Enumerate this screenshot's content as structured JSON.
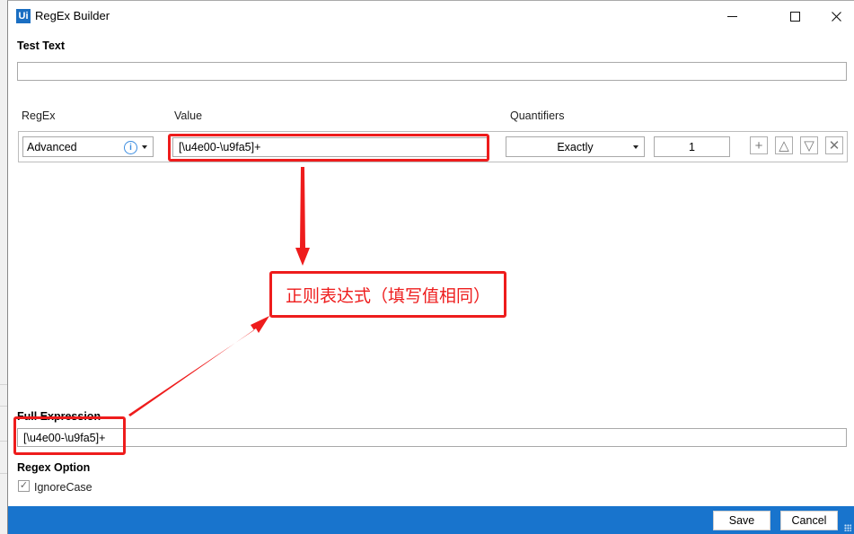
{
  "window": {
    "title": "RegEx Builder",
    "logo_text": "Ui",
    "controls": {
      "minimize": "minimize-icon",
      "maximize": "maximize-icon",
      "close": "close-icon"
    }
  },
  "test_text": {
    "label": "Test Text",
    "value": ""
  },
  "regex_table": {
    "headers": {
      "regex": "RegEx",
      "value": "Value",
      "quantifiers": "Quantifiers"
    },
    "rows": [
      {
        "regex_type": "Advanced",
        "value": "[\\u4e00-\\u9fa5]+",
        "quantifier": "Exactly",
        "count": "1"
      }
    ],
    "row_actions": [
      "add",
      "move-up",
      "move-down",
      "delete"
    ],
    "row_action_glyphs": {
      "add": "+",
      "up": "△",
      "down": "▽",
      "delete": "✕"
    },
    "info_glyph": "i"
  },
  "annotation": {
    "callout_text": "正则表达式（填写值相同）",
    "color": "#ee1c1c"
  },
  "full_expression": {
    "label": "Full Expression",
    "value": "[\\u4e00-\\u9fa5]+"
  },
  "regex_option": {
    "label": "Regex Option",
    "ignore_case_label": "IgnoreCase",
    "ignore_case_checked": true,
    "check_glyph": "✓"
  },
  "footer": {
    "save_label": "Save",
    "cancel_label": "Cancel",
    "color": "#1874cd"
  }
}
